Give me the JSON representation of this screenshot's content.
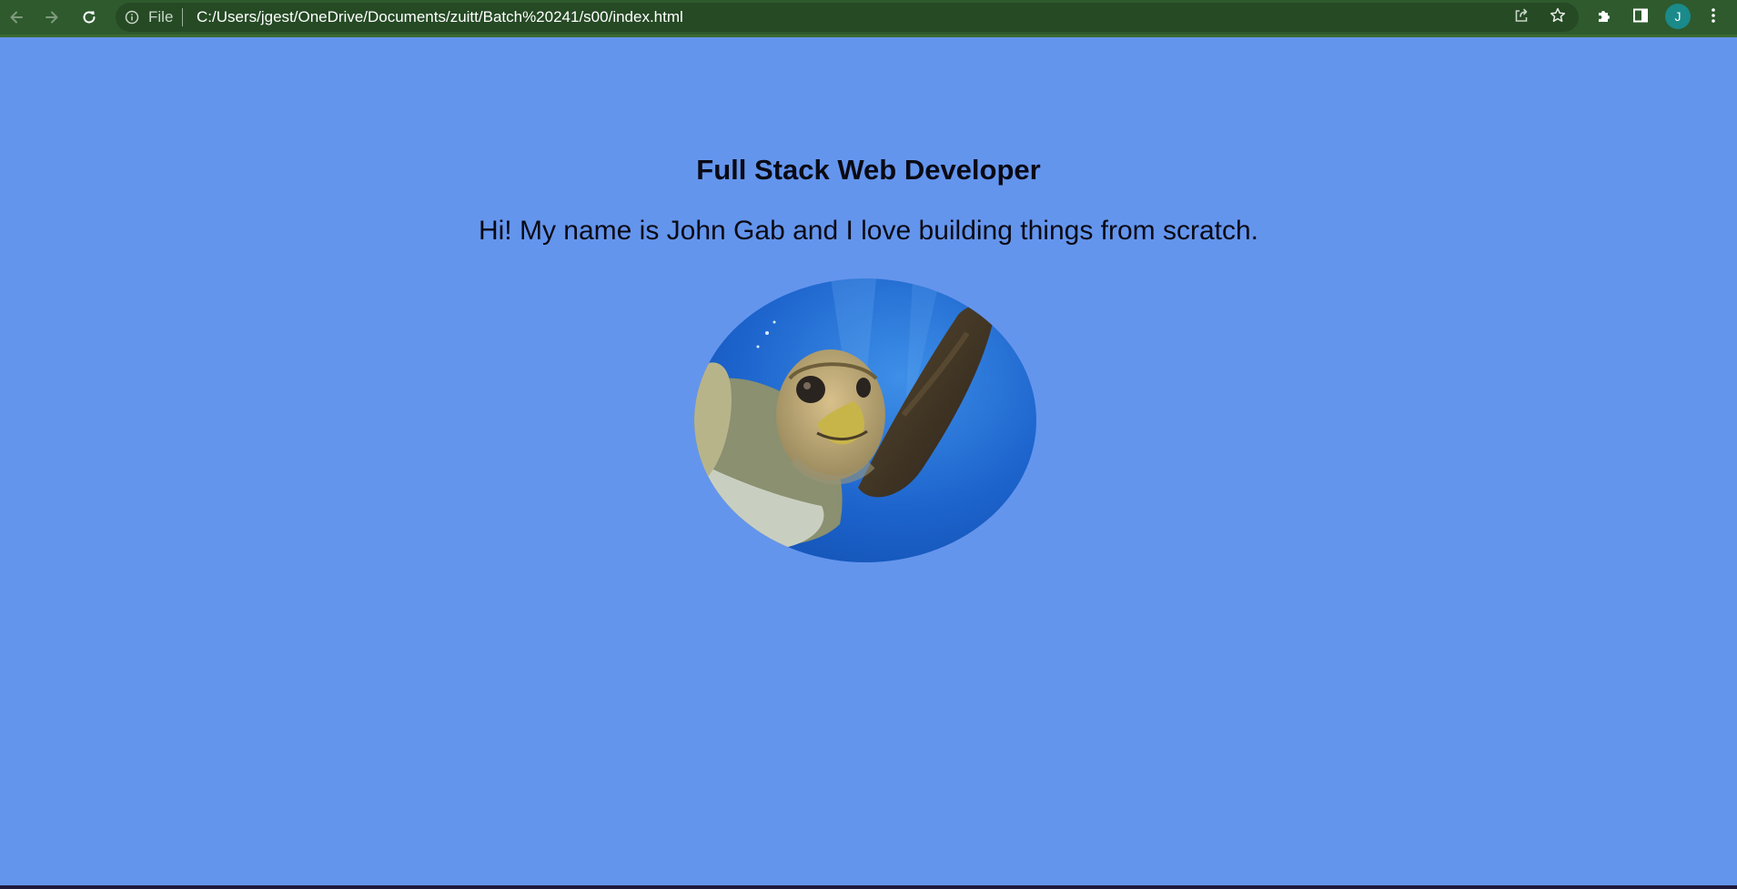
{
  "browser": {
    "site_info_label": "File",
    "url": "C:/Users/jgest/OneDrive/Documents/zuitt/Batch%20241/s00/index.html",
    "profile_initial": "J",
    "colors": {
      "toolbar": "#2e5a2e",
      "omnibox": "#254a24",
      "avatar": "#1a8a8a"
    }
  },
  "page": {
    "heading": "Full Stack Web Developer",
    "intro": "Hi! My name is John Gab and I love building things from scratch.",
    "background_color": "#6495ed",
    "image": {
      "subject": "sea turtle swimming underwater"
    }
  },
  "icons": {
    "back": "arrow-left-icon",
    "forward": "arrow-right-icon",
    "reload": "reload-icon",
    "site_info": "info-icon",
    "share": "share-icon",
    "bookmark": "star-icon",
    "extensions": "puzzle-icon",
    "side_panel": "side-panel-icon",
    "menu": "kebab-menu-icon"
  }
}
